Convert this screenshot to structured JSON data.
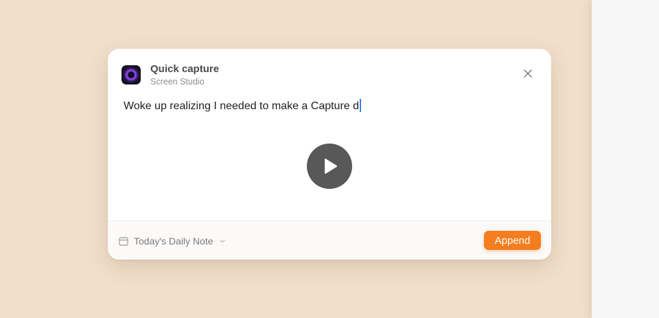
{
  "dialog": {
    "app_title": "Quick capture",
    "app_subtitle": "Screen Studio",
    "content_text": "Woke up realizing I needed to make a Capture d"
  },
  "footer": {
    "destination_label": "Today's Daily Note",
    "append_label": "Append"
  },
  "icons": {
    "app": "screen-studio-icon",
    "close": "close-icon",
    "play": "play-icon",
    "calendar": "calendar-icon",
    "chevron": "chevron-down-icon"
  },
  "colors": {
    "accent": "#f47d1f",
    "background": "#f1dfcb",
    "caret": "#3d7bf7"
  }
}
